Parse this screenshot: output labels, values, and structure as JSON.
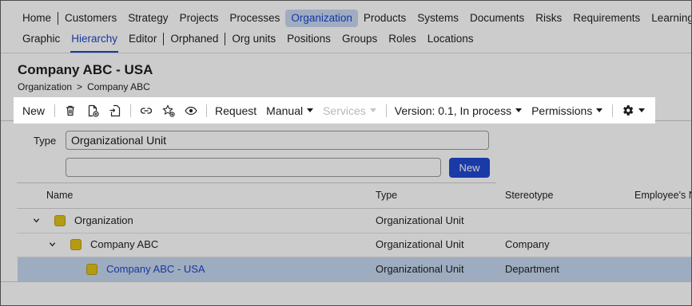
{
  "nav": {
    "primary": [
      "Home",
      "Customers",
      "Strategy",
      "Projects",
      "Processes",
      "Organization",
      "Products",
      "Systems",
      "Documents",
      "Risks",
      "Requirements",
      "Learning"
    ],
    "primary_active": "Organization",
    "secondary": [
      "Graphic",
      "Hierarchy",
      "Editor",
      "Orphaned",
      "Org units",
      "Positions",
      "Groups",
      "Roles",
      "Locations"
    ],
    "secondary_active": "Hierarchy"
  },
  "page": {
    "title": "Company ABC - USA",
    "breadcrumb": [
      "Organization",
      ">",
      "Company ABC"
    ]
  },
  "toolbar": {
    "new_label": "New",
    "icons": [
      "trash-icon",
      "document-add-icon",
      "import-icon",
      "link-icon",
      "star-add-icon",
      "eye-icon"
    ],
    "request_label": "Request",
    "manual_label": "Manual",
    "services_label": "Services",
    "version_label": "Version: 0.1, In process",
    "permissions_label": "Permissions",
    "settings_icon": "gear-icon"
  },
  "form": {
    "type_label": "Type",
    "type_value": "Organizational Unit",
    "name_value": "",
    "new_button": "New"
  },
  "table": {
    "columns": [
      "Name",
      "Type",
      "Stereotype",
      "Employee's N"
    ],
    "rows": [
      {
        "name": "Organization",
        "type": "Organizational Unit",
        "stereotype": "",
        "level": 0,
        "expanded": true,
        "selected": false
      },
      {
        "name": "Company ABC",
        "type": "Organizational Unit",
        "stereotype": "Company",
        "level": 1,
        "expanded": true,
        "selected": false
      },
      {
        "name": "Company ABC - USA",
        "type": "Organizational Unit",
        "stereotype": "Department",
        "level": 2,
        "expanded": false,
        "selected": true
      }
    ]
  },
  "colors": {
    "accent": "#1f46c6",
    "button": "#2149d1",
    "selected_row": "#c6d7f0",
    "folder": "#e2c21a"
  }
}
